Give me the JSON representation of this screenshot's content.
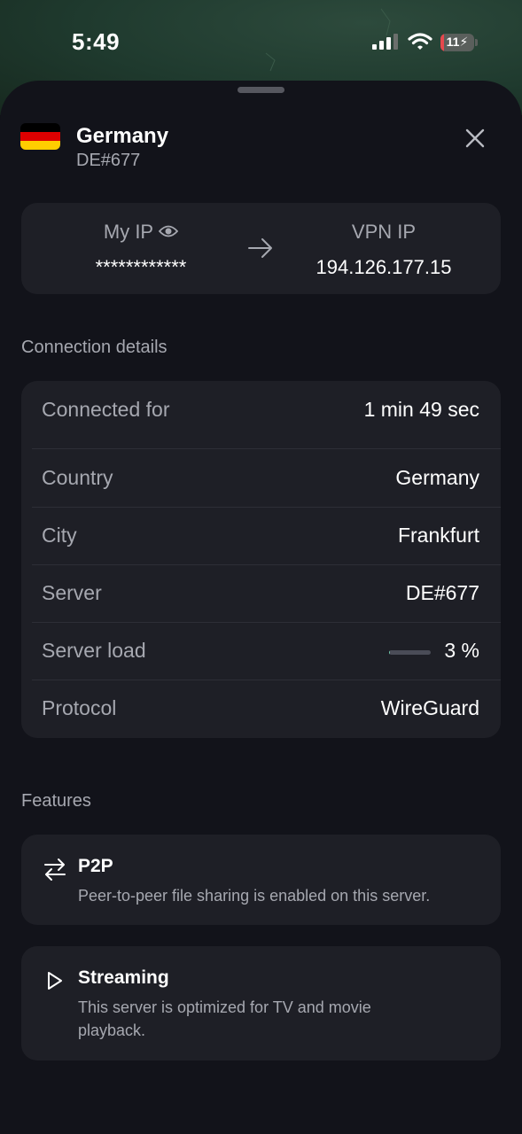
{
  "status_bar": {
    "time": "5:49",
    "battery_level": "11",
    "battery_fraction": 0.11
  },
  "header": {
    "country": "Germany",
    "server": "DE#677",
    "flag_colors": [
      "#000000",
      "#dd0000",
      "#ffce00"
    ],
    "close_icon": "close-icon"
  },
  "ip_card": {
    "my_ip_label": "My IP",
    "my_ip_value": "************",
    "vpn_ip_label": "VPN IP",
    "vpn_ip_value": "194.126.177.15"
  },
  "connection_details": {
    "title": "Connection details",
    "rows": [
      {
        "label": "Connected for",
        "value": "1 min 49 sec"
      },
      {
        "label": "Country",
        "value": "Germany"
      },
      {
        "label": "City",
        "value": "Frankfurt"
      },
      {
        "label": "Server",
        "value": "DE#677"
      },
      {
        "label": "Server load",
        "value": "3 %"
      },
      {
        "label": "Protocol",
        "value": "WireGuard"
      }
    ],
    "server_load_fraction": 0.03
  },
  "features": {
    "title": "Features",
    "items": [
      {
        "title": "P2P",
        "description": "Peer-to-peer file sharing is enabled on this server.",
        "icon": "swap-arrows-icon"
      },
      {
        "title": "Streaming",
        "description": "This server is optimized for TV and movie playback.",
        "icon": "play-icon"
      }
    ]
  },
  "colors": {
    "sheet_background": "#12131a",
    "card_background": "#1e1f26",
    "text_primary": "#ffffff",
    "text_secondary": "#a6a8b0",
    "load_accent": "#6ec7a8",
    "battery_low": "#e5484d"
  }
}
